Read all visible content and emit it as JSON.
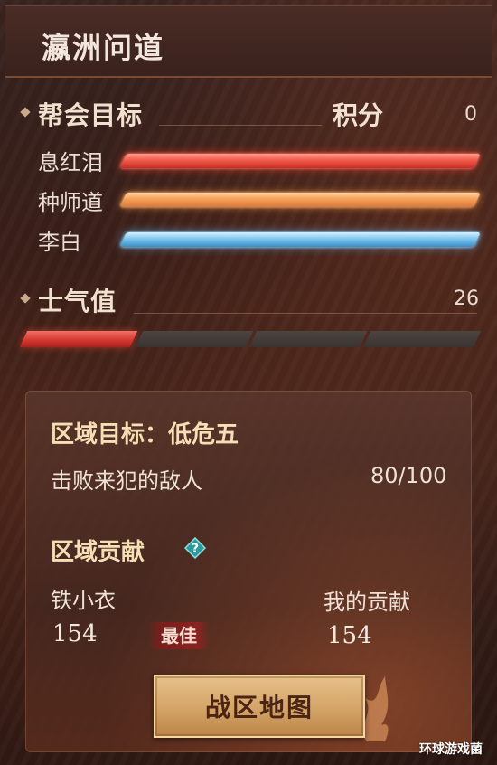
{
  "panel": {
    "title": "瀛洲问道"
  },
  "guild_goal": {
    "heading": "帮会目标",
    "score_label": "积分",
    "score_value": "0",
    "factions": [
      {
        "name": "息红泪",
        "color": "#f15a4a"
      },
      {
        "name": "种师道",
        "color": "#f5a058"
      },
      {
        "name": "李白",
        "color": "#7cc6ee"
      }
    ]
  },
  "morale": {
    "heading": "士气值",
    "value": "26",
    "segments_total": 4,
    "segments_filled": 1
  },
  "region": {
    "goal_title": "区域目标：低危五",
    "task": "击败来犯的敌人",
    "progress": "80/100",
    "contribution_heading": "区域贡献",
    "top_player_name": "铁小衣",
    "top_player_score": "154",
    "best_badge": "最佳",
    "my_label": "我的贡献",
    "my_score": "154"
  },
  "button": {
    "map_label": "战区地图"
  },
  "watermark": "环球游戏菌"
}
